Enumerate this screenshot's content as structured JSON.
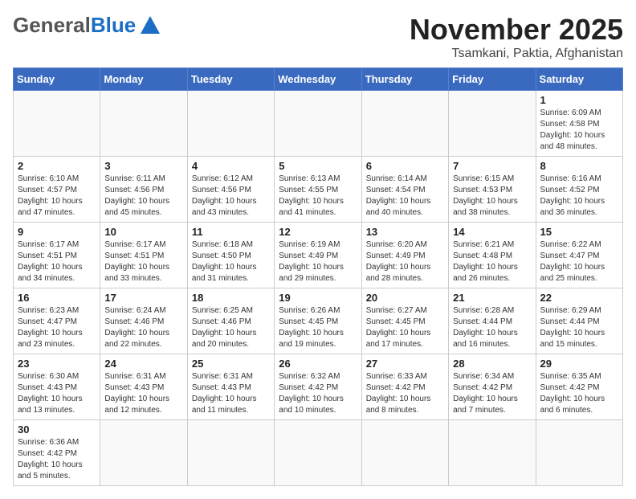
{
  "header": {
    "logo_general": "General",
    "logo_blue": "Blue",
    "month_title": "November 2025",
    "subtitle": "Tsamkani, Paktia, Afghanistan"
  },
  "days_of_week": [
    "Sunday",
    "Monday",
    "Tuesday",
    "Wednesday",
    "Thursday",
    "Friday",
    "Saturday"
  ],
  "weeks": [
    [
      {
        "day": "",
        "info": ""
      },
      {
        "day": "",
        "info": ""
      },
      {
        "day": "",
        "info": ""
      },
      {
        "day": "",
        "info": ""
      },
      {
        "day": "",
        "info": ""
      },
      {
        "day": "",
        "info": ""
      },
      {
        "day": "1",
        "info": "Sunrise: 6:09 AM\nSunset: 4:58 PM\nDaylight: 10 hours\nand 48 minutes."
      }
    ],
    [
      {
        "day": "2",
        "info": "Sunrise: 6:10 AM\nSunset: 4:57 PM\nDaylight: 10 hours\nand 47 minutes."
      },
      {
        "day": "3",
        "info": "Sunrise: 6:11 AM\nSunset: 4:56 PM\nDaylight: 10 hours\nand 45 minutes."
      },
      {
        "day": "4",
        "info": "Sunrise: 6:12 AM\nSunset: 4:56 PM\nDaylight: 10 hours\nand 43 minutes."
      },
      {
        "day": "5",
        "info": "Sunrise: 6:13 AM\nSunset: 4:55 PM\nDaylight: 10 hours\nand 41 minutes."
      },
      {
        "day": "6",
        "info": "Sunrise: 6:14 AM\nSunset: 4:54 PM\nDaylight: 10 hours\nand 40 minutes."
      },
      {
        "day": "7",
        "info": "Sunrise: 6:15 AM\nSunset: 4:53 PM\nDaylight: 10 hours\nand 38 minutes."
      },
      {
        "day": "8",
        "info": "Sunrise: 6:16 AM\nSunset: 4:52 PM\nDaylight: 10 hours\nand 36 minutes."
      }
    ],
    [
      {
        "day": "9",
        "info": "Sunrise: 6:17 AM\nSunset: 4:51 PM\nDaylight: 10 hours\nand 34 minutes."
      },
      {
        "day": "10",
        "info": "Sunrise: 6:17 AM\nSunset: 4:51 PM\nDaylight: 10 hours\nand 33 minutes."
      },
      {
        "day": "11",
        "info": "Sunrise: 6:18 AM\nSunset: 4:50 PM\nDaylight: 10 hours\nand 31 minutes."
      },
      {
        "day": "12",
        "info": "Sunrise: 6:19 AM\nSunset: 4:49 PM\nDaylight: 10 hours\nand 29 minutes."
      },
      {
        "day": "13",
        "info": "Sunrise: 6:20 AM\nSunset: 4:49 PM\nDaylight: 10 hours\nand 28 minutes."
      },
      {
        "day": "14",
        "info": "Sunrise: 6:21 AM\nSunset: 4:48 PM\nDaylight: 10 hours\nand 26 minutes."
      },
      {
        "day": "15",
        "info": "Sunrise: 6:22 AM\nSunset: 4:47 PM\nDaylight: 10 hours\nand 25 minutes."
      }
    ],
    [
      {
        "day": "16",
        "info": "Sunrise: 6:23 AM\nSunset: 4:47 PM\nDaylight: 10 hours\nand 23 minutes."
      },
      {
        "day": "17",
        "info": "Sunrise: 6:24 AM\nSunset: 4:46 PM\nDaylight: 10 hours\nand 22 minutes."
      },
      {
        "day": "18",
        "info": "Sunrise: 6:25 AM\nSunset: 4:46 PM\nDaylight: 10 hours\nand 20 minutes."
      },
      {
        "day": "19",
        "info": "Sunrise: 6:26 AM\nSunset: 4:45 PM\nDaylight: 10 hours\nand 19 minutes."
      },
      {
        "day": "20",
        "info": "Sunrise: 6:27 AM\nSunset: 4:45 PM\nDaylight: 10 hours\nand 17 minutes."
      },
      {
        "day": "21",
        "info": "Sunrise: 6:28 AM\nSunset: 4:44 PM\nDaylight: 10 hours\nand 16 minutes."
      },
      {
        "day": "22",
        "info": "Sunrise: 6:29 AM\nSunset: 4:44 PM\nDaylight: 10 hours\nand 15 minutes."
      }
    ],
    [
      {
        "day": "23",
        "info": "Sunrise: 6:30 AM\nSunset: 4:43 PM\nDaylight: 10 hours\nand 13 minutes."
      },
      {
        "day": "24",
        "info": "Sunrise: 6:31 AM\nSunset: 4:43 PM\nDaylight: 10 hours\nand 12 minutes."
      },
      {
        "day": "25",
        "info": "Sunrise: 6:31 AM\nSunset: 4:43 PM\nDaylight: 10 hours\nand 11 minutes."
      },
      {
        "day": "26",
        "info": "Sunrise: 6:32 AM\nSunset: 4:42 PM\nDaylight: 10 hours\nand 10 minutes."
      },
      {
        "day": "27",
        "info": "Sunrise: 6:33 AM\nSunset: 4:42 PM\nDaylight: 10 hours\nand 8 minutes."
      },
      {
        "day": "28",
        "info": "Sunrise: 6:34 AM\nSunset: 4:42 PM\nDaylight: 10 hours\nand 7 minutes."
      },
      {
        "day": "29",
        "info": "Sunrise: 6:35 AM\nSunset: 4:42 PM\nDaylight: 10 hours\nand 6 minutes."
      }
    ],
    [
      {
        "day": "30",
        "info": "Sunrise: 6:36 AM\nSunset: 4:42 PM\nDaylight: 10 hours\nand 5 minutes."
      },
      {
        "day": "",
        "info": ""
      },
      {
        "day": "",
        "info": ""
      },
      {
        "day": "",
        "info": ""
      },
      {
        "day": "",
        "info": ""
      },
      {
        "day": "",
        "info": ""
      },
      {
        "day": "",
        "info": ""
      }
    ]
  ]
}
